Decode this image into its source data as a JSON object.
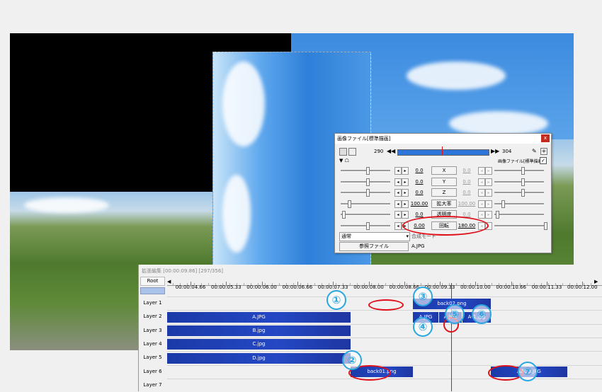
{
  "dialog": {
    "title": "画像ファイル[標準描画]",
    "close": "x",
    "frame_start": "290",
    "frame_end": "304",
    "object_name": "画像ファイル[標準描画]",
    "params": [
      {
        "left": "0.0",
        "label": "X",
        "right": "0.0",
        "dim": true
      },
      {
        "left": "0.0",
        "label": "Y",
        "right": "0.0",
        "dim": true
      },
      {
        "left": "0.0",
        "label": "Z",
        "right": "0.0",
        "dim": true
      },
      {
        "left": "100.00",
        "label": "拡大率",
        "right": "100.00",
        "dim": true
      },
      {
        "left": "0.0",
        "label": "透明度",
        "right": "0.0",
        "dim": true
      },
      {
        "left": "0.00",
        "label": "回転",
        "right": "180.00",
        "dim": false
      }
    ],
    "blend_mode": "通常",
    "sound_label": "合成モード",
    "ref_button": "参照ファイル",
    "file_name": "A.JPG"
  },
  "timeline": {
    "title": "拡張編集 [00:00:09.86] [297/356]",
    "root": "Root",
    "ticks": [
      "00:00:04.66",
      "00:00:05.33",
      "00:00:06.00",
      "00:00:06.66",
      "00:00:07.33",
      "00:00:08.00",
      "00:00:08.66",
      "00:00:09.33",
      "00:00:10.00",
      "00:00:10.66",
      "00:00:11.33",
      "00:00:12.00"
    ],
    "layers": [
      "Layer 1",
      "Layer 2",
      "Layer 3",
      "Layer 4",
      "Layer 5",
      "Layer 6",
      "Layer 7"
    ],
    "clips": {
      "l1_back02": "back02.png",
      "l2_a": "A.JPG",
      "l2_a2": "A.JPG",
      "l2_a3": "A.JPG",
      "l2_a4": "A-1.jpg",
      "l3_b": "B.jpg",
      "l4_c": "C.jpg",
      "l5_d": "D.jpg",
      "l6_back01": "back01.png",
      "l6_abcd": "ABCD.JPG"
    }
  },
  "badges": [
    "①",
    "②",
    "③",
    "④",
    "⑤",
    "⑥",
    "⑦"
  ],
  "colors": {
    "clip": "#2447c4",
    "annotation": "#2aa6e0",
    "highlight": "#e0101a"
  }
}
